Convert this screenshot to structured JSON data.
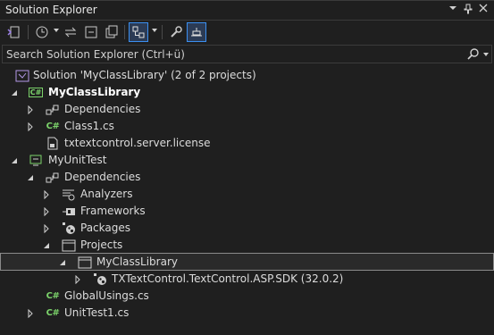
{
  "window": {
    "title": "Solution Explorer",
    "controls": [
      "chevron-down-icon",
      "pin-icon",
      "close-icon"
    ]
  },
  "colors": {
    "background": "#1f1f1f",
    "accent": "#3b8ff0",
    "csharp": "#7cd46b",
    "selection_border": "#8a8a8a"
  },
  "toolbar": {
    "buttons": [
      "switch-views-icon",
      "pending-changes-icon",
      "sync-icon",
      "collapse-all-icon",
      "show-all-files-icon",
      "view-class-diagram-icon",
      "properties-icon",
      "preview-selected-icon"
    ]
  },
  "search": {
    "placeholder": "Search Solution Explorer (Ctrl+ü)"
  },
  "tree": {
    "solution": "Solution 'MyClassLibrary' (2 of 2 projects)",
    "project1": "MyClassLibrary",
    "p1_dependencies": "Dependencies",
    "p1_class1": "Class1.cs",
    "p1_license": "txtextcontrol.server.license",
    "project2": "MyUnitTest",
    "p2_dependencies": "Dependencies",
    "p2_analyzers": "Analyzers",
    "p2_frameworks": "Frameworks",
    "p2_packages": "Packages",
    "p2_projects": "Projects",
    "p2_ref_myclasslibrary": "MyClassLibrary",
    "p2_package_txtc": "TXTextControl.TextControl.ASP.SDK (32.0.2)",
    "p2_globalusings": "GlobalUsings.cs",
    "p2_unittest1": "UnitTest1.cs"
  }
}
